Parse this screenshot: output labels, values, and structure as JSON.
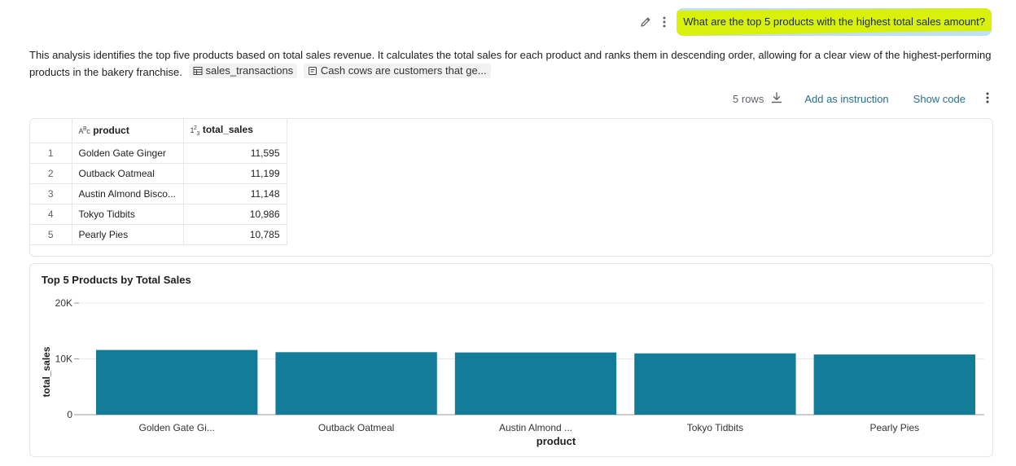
{
  "question": {
    "text": "What are the top 5 products with the highest total sales amount?"
  },
  "description": {
    "text": "This analysis identifies the top five products based on total sales revenue. It calculates the total sales for each product and ranks them in descending order, allowing for a clear view of the highest-performing products in the bakery franchise.",
    "chips": [
      "sales_transactions",
      "Cash cows are customers that ge..."
    ]
  },
  "toolbar": {
    "rows_label": "5 rows",
    "add_instruction": "Add as instruction",
    "show_code": "Show code"
  },
  "table": {
    "columns": [
      {
        "type_icon": "ABC",
        "name": "product"
      },
      {
        "type_icon": "123",
        "name": "total_sales"
      }
    ],
    "rows": [
      {
        "idx": "1",
        "product": "Golden Gate Ginger",
        "total_sales": "11,595"
      },
      {
        "idx": "2",
        "product": "Outback Oatmeal",
        "total_sales": "11,199"
      },
      {
        "idx": "3",
        "product": "Austin Almond Bisco...",
        "total_sales": "11,148"
      },
      {
        "idx": "4",
        "product": "Tokyo Tidbits",
        "total_sales": "10,986"
      },
      {
        "idx": "5",
        "product": "Pearly Pies",
        "total_sales": "10,785"
      }
    ]
  },
  "chart_data": {
    "type": "bar",
    "title": "Top 5 Products by Total Sales",
    "xlabel": "product",
    "ylabel": "total_sales",
    "categories": [
      "Golden Gate Gi...",
      "Outback Oatmeal",
      "Austin Almond ...",
      "Tokyo Tidbits",
      "Pearly Pies"
    ],
    "values": [
      11595,
      11199,
      11148,
      10986,
      10785
    ],
    "ylim": [
      0,
      20000
    ],
    "yticks": [
      {
        "value": 0,
        "label": "0"
      },
      {
        "value": 10000,
        "label": "10K"
      },
      {
        "value": 20000,
        "label": "20K"
      }
    ],
    "bar_color": "#137c99",
    "grid": true
  },
  "colors": {
    "question_bubble": "#bfdff4",
    "highlight": "#d9f00a",
    "link": "#2a6f8f",
    "bar": "#137c99"
  },
  "icons": [
    "pencil-icon",
    "vertical-dots-icon",
    "table-icon",
    "instruction-doc-icon",
    "download-icon",
    "more-options-icon"
  ]
}
